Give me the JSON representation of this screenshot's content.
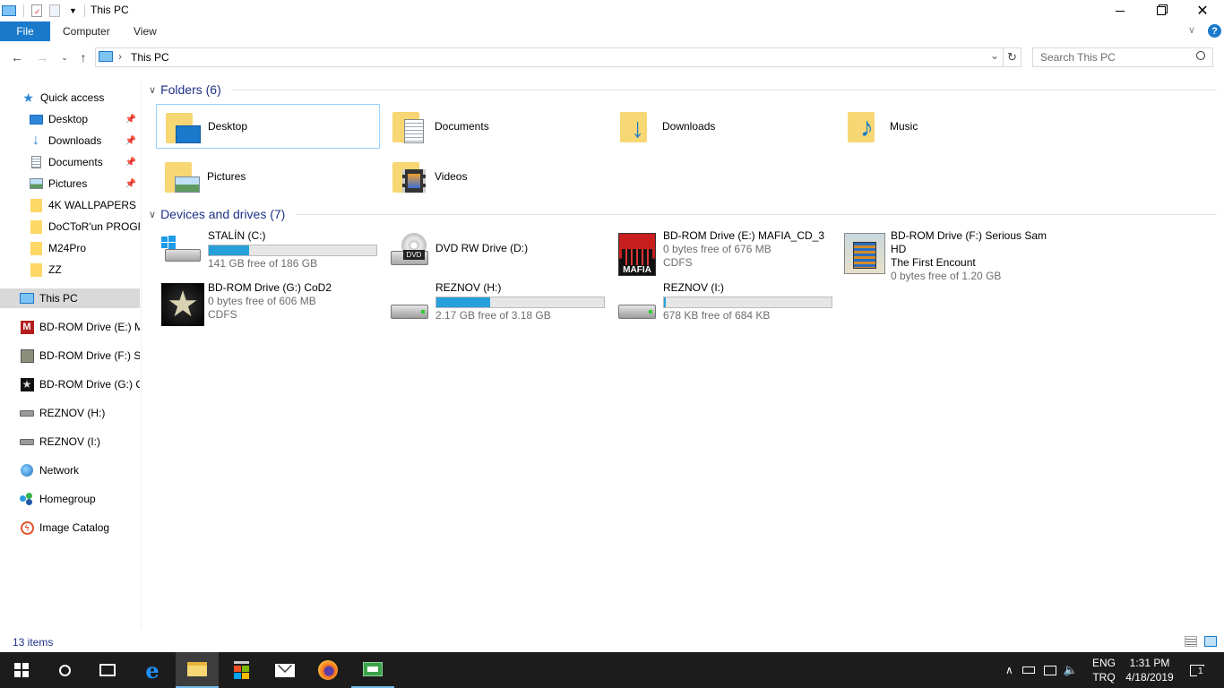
{
  "window": {
    "title": "This PC",
    "minimize_icon": "minimize-icon",
    "maximize_icon": "restore-icon",
    "close_icon": "close-icon"
  },
  "ribbon": {
    "tabs": [
      "File",
      "Computer",
      "View"
    ],
    "help_label": "?"
  },
  "address": {
    "path_label": "This PC",
    "search_placeholder": "Search This PC"
  },
  "nav": {
    "quick_access": "Quick access",
    "pinned": [
      {
        "label": "Desktop",
        "icon": "desktop-icon"
      },
      {
        "label": "Downloads",
        "icon": "downloads-icon"
      },
      {
        "label": "Documents",
        "icon": "documents-icon"
      },
      {
        "label": "Pictures",
        "icon": "pictures-icon"
      }
    ],
    "folders": [
      {
        "label": "4K WALLPAPERS"
      },
      {
        "label": "DoCToR'un PROGRA"
      },
      {
        "label": "M24Pro"
      },
      {
        "label": "ZZ"
      }
    ],
    "this_pc": "This PC",
    "drives": [
      {
        "label": "BD-ROM Drive (E:) M"
      },
      {
        "label": "BD-ROM Drive (F:) Se"
      },
      {
        "label": "BD-ROM Drive (G:) C"
      },
      {
        "label": "REZNOV (H:)"
      },
      {
        "label": "REZNOV (I:)"
      }
    ],
    "network": "Network",
    "homegroup": "Homegroup",
    "image_catalog": "Image Catalog"
  },
  "folders_group": {
    "header": "Folders (6)",
    "items": [
      {
        "label": "Desktop",
        "icon": "desktop-folder-icon"
      },
      {
        "label": "Documents",
        "icon": "documents-folder-icon"
      },
      {
        "label": "Downloads",
        "icon": "downloads-folder-icon"
      },
      {
        "label": "Music",
        "icon": "music-folder-icon"
      },
      {
        "label": "Pictures",
        "icon": "pictures-folder-icon"
      },
      {
        "label": "Videos",
        "icon": "videos-folder-icon"
      }
    ]
  },
  "drives_group": {
    "header": "Devices and drives (7)",
    "items": [
      {
        "name": "STALİN (C:)",
        "line2": "141 GB free of 186 GB",
        "line3": "",
        "used_fraction": 0.24
      },
      {
        "name": "DVD RW Drive (D:)",
        "line2": "",
        "line3": ""
      },
      {
        "name": "BD-ROM Drive (E:) MAFIA_CD_3",
        "line2": "0 bytes free of 676 MB",
        "line3": "CDFS"
      },
      {
        "name": "BD-ROM Drive (F:) Serious Sam HD",
        "name2": "The First Encount",
        "line2": "0 bytes free of 1.20 GB",
        "line3": ""
      },
      {
        "name": "BD-ROM Drive (G:) CoD2",
        "line2": "0 bytes free of 606 MB",
        "line3": "CDFS"
      },
      {
        "name": "REZNOV (H:)",
        "line2": "2.17 GB free of 3.18 GB",
        "line3": "",
        "used_fraction": 0.32
      },
      {
        "name": "REZNOV (I:)",
        "line2": "678 KB free of 684 KB",
        "line3": "",
        "used_fraction": 0.01
      }
    ]
  },
  "status": {
    "items_count": "13 items"
  },
  "taskbar": {
    "lang": "ENG",
    "layout": "TRQ",
    "time": "1:31 PM",
    "date": "4/18/2019",
    "notification_count": "1"
  },
  "colors": {
    "accent": "#1979ca",
    "bar_fill": "#26a0da",
    "group_header": "#1e3287",
    "selection": "#cce8ff"
  }
}
